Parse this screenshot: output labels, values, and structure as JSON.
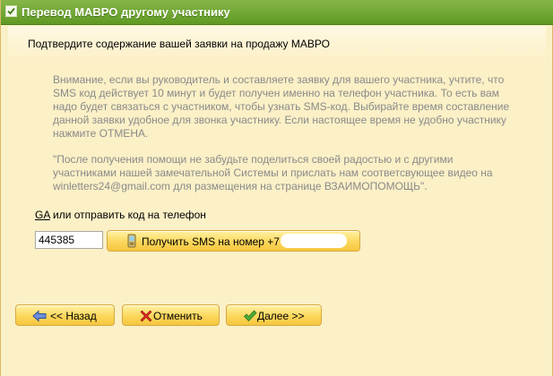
{
  "window": {
    "title": "Перевод МАВРО другому участнику"
  },
  "header": {
    "text": "Подтвердите содержание вашей заявки на продажу МАВРО"
  },
  "notice": {
    "paragraph1": "Внимание, если вы руководитель и составляете заявку для вашего участника, учтите, что SMS код действует 10 минут и будет получен именно на телефон участника. То есть вам надо будет связаться с участником, чтобы узнать SMS-код. Выбирайте время составление данной заявки удобное для звонка участнику. Если настоящее время не удобно участнику нажмите ОТМЕНА.",
    "paragraph2": "\"После получения помощи не забудьте поделиться своей радостью и с другими участниками нашей замечательной Системы и прислать нам соответсвующее видео на winletters24@gmail.com для размещения на странице ВЗАИМОПОМОЩЬ\"."
  },
  "code": {
    "ga_link": "GA",
    "alt_text": " или отправить код на телефон",
    "value": "445385",
    "sms_button_label": "Получить SMS на номер +7"
  },
  "footer": {
    "back_label": "<< Назад",
    "cancel_label": "Отменить",
    "next_label": "Далее >>"
  },
  "colors": {
    "titlebar": "#6fa530",
    "background": "#fbf0c6",
    "button": "#fcd75c"
  }
}
